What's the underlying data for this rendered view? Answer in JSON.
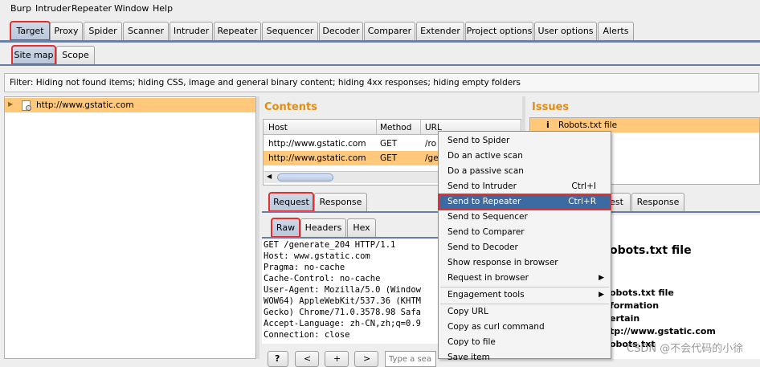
{
  "menu": [
    "Burp",
    "Intruder",
    "Repeater",
    "Window",
    "Help"
  ],
  "tool_tabs": [
    "Target",
    "Proxy",
    "Spider",
    "Scanner",
    "Intruder",
    "Repeater",
    "Sequencer",
    "Decoder",
    "Comparer",
    "Extender",
    "Project options",
    "User options",
    "Alerts"
  ],
  "sub_tabs": [
    "Site map",
    "Scope"
  ],
  "filter_text": "Filter:  Hiding not found items;  hiding CSS, image and general binary content;  hiding 4xx responses;  hiding empty folders",
  "site_tree": {
    "item": "http://www.gstatic.com"
  },
  "contents": {
    "heading": "Contents",
    "columns": [
      "Host",
      "Method",
      "URL"
    ],
    "rows": [
      [
        "http://www.gstatic.com",
        "GET",
        "/ro"
      ],
      [
        "http://www.gstatic.com",
        "GET",
        "/ge"
      ]
    ]
  },
  "issues": {
    "heading": "Issues",
    "items": [
      "Robots.txt file"
    ],
    "detail_title": "obots.txt file",
    "detail_lines": [
      "obots.txt file",
      "formation",
      "ertain",
      "tp://www.gstatic.com",
      "obots.txt"
    ]
  },
  "request_tabs": [
    "Request",
    "Response"
  ],
  "format_tabs": [
    "Raw",
    "Headers",
    "Hex"
  ],
  "issue_tabs": [
    "est",
    "Response"
  ],
  "request_lines": [
    "GET /generate_204 HTTP/1.1",
    "Host: www.gstatic.com",
    "Pragma: no-cache",
    "Cache-Control: no-cache",
    "User-Agent: Mozilla/5.0 (Window",
    "WOW64) AppleWebKit/537.36 (KHTM",
    "Gecko) Chrome/71.0.3578.98 Safa",
    "Accept-Language: zh-CN,zh;q=0.9",
    "Connection: close"
  ],
  "search_placeholder": "Type a search",
  "context_menu": {
    "items": [
      {
        "label": "Send to Spider",
        "shortcut": ""
      },
      {
        "label": "Do an active scan",
        "shortcut": ""
      },
      {
        "label": "Do a passive scan",
        "shortcut": ""
      },
      {
        "label": "Send to Intruder",
        "shortcut": "Ctrl+I"
      },
      {
        "label": "Send to Repeater",
        "shortcut": "Ctrl+R"
      },
      {
        "label": "Send to Sequencer",
        "shortcut": ""
      },
      {
        "label": "Send to Comparer",
        "shortcut": ""
      },
      {
        "label": "Send to Decoder",
        "shortcut": ""
      },
      {
        "label": "Show response in browser",
        "shortcut": ""
      },
      {
        "label": "Request in browser",
        "shortcut": ""
      },
      {
        "label": "Engagement tools",
        "shortcut": ""
      },
      {
        "label": "Copy URL",
        "shortcut": ""
      },
      {
        "label": "Copy as curl command",
        "shortcut": ""
      },
      {
        "label": "Copy to file",
        "shortcut": ""
      },
      {
        "label": "Save item",
        "shortcut": ""
      }
    ]
  },
  "watermark": "CSDN @不会代码的小徐",
  "colors": {
    "accent": "#e38d13",
    "selected_row": "#ffc87a",
    "menu_highlight": "#3d6aa0",
    "annotation": "#e03030"
  }
}
